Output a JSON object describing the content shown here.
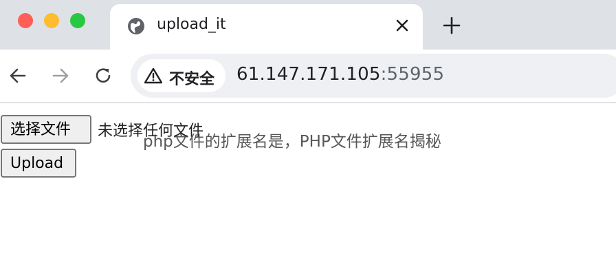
{
  "window": {
    "tab": {
      "title": "upload_it",
      "icon": "globe-icon"
    },
    "new_tab_icon": "plus-icon",
    "close_icon": "close-icon"
  },
  "toolbar": {
    "back_icon": "back-arrow-icon",
    "forward_icon": "forward-arrow-icon",
    "reload_icon": "reload-icon",
    "security_label": "不安全",
    "security_icon": "warning-triangle-icon",
    "url_host": "61.147.171.105",
    "url_port": ":55955"
  },
  "page": {
    "choose_file_label": "选择文件",
    "file_status": "未选择任何文件",
    "upload_label": "Upload"
  },
  "overlay": {
    "watermark_text": "php文件的扩展名是，PHP文件扩展名揭秘"
  },
  "colors": {
    "titlebar": "#dee1e6",
    "traffic_red": "#ff5f57",
    "traffic_yellow": "#febc2e",
    "traffic_green": "#28c840",
    "omnibox": "#eef0f3"
  }
}
